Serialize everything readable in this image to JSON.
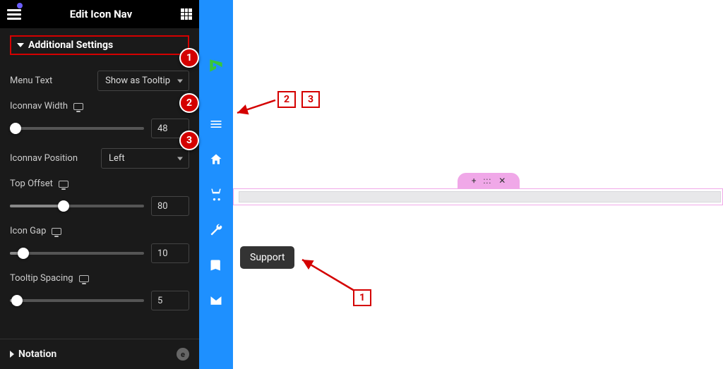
{
  "panel": {
    "title": "Edit Icon Nav",
    "section1": "Additional Settings",
    "menu_text_label": "Menu Text",
    "menu_text_value": "Show as Tooltip",
    "iconnav_width_label": "Iconnav Width",
    "iconnav_width_value": "48",
    "iconnav_position_label": "Iconnav Position",
    "iconnav_position_value": "Left",
    "top_offset_label": "Top Offset",
    "top_offset_value": "80",
    "icon_gap_label": "Icon Gap",
    "icon_gap_value": "10",
    "tooltip_spacing_label": "Tooltip Spacing",
    "tooltip_spacing_value": "5",
    "notation_label": "Notation"
  },
  "tooltip": {
    "text": "Support"
  },
  "annotations": {
    "c1": "1",
    "c2": "2",
    "c3": "3",
    "b2": "2",
    "b3": "3",
    "b1": "1"
  },
  "widget_controls": {
    "plus": "+",
    "drag": ":::",
    "close": "✕"
  }
}
